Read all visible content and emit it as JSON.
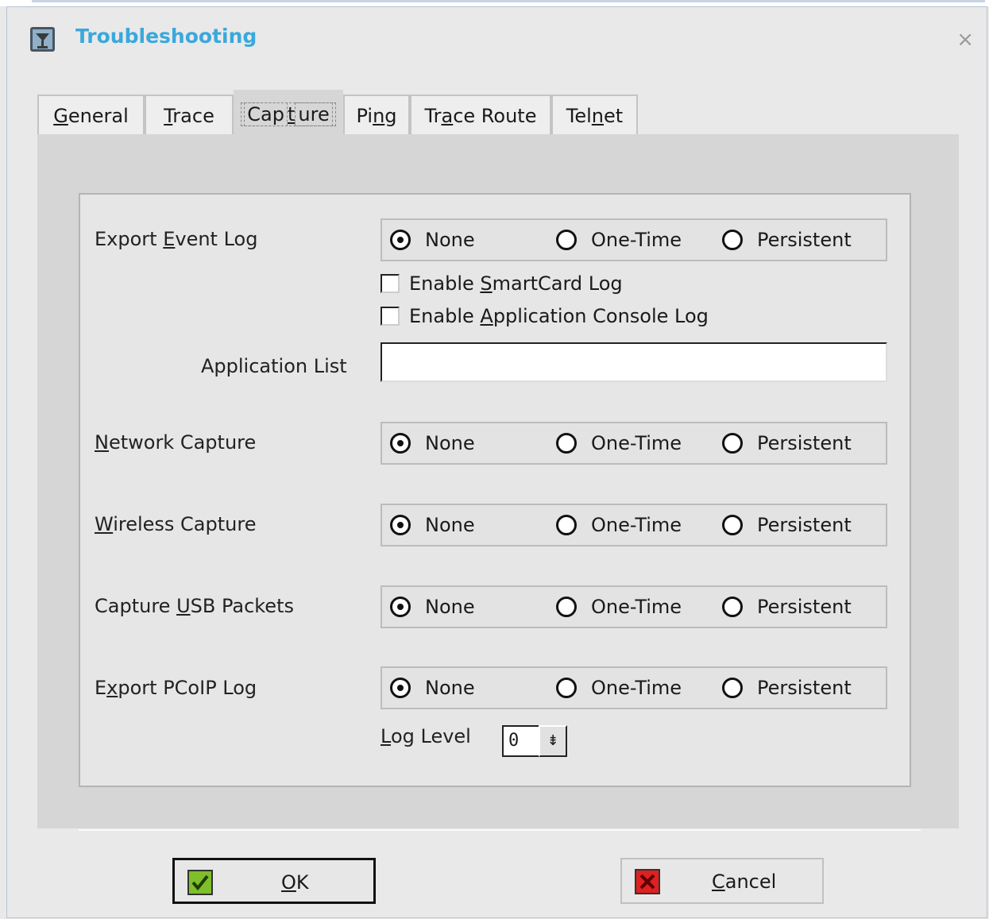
{
  "window": {
    "title": "Troubleshooting",
    "close_glyph": "×",
    "app_icon": "network-tool-icon"
  },
  "tabs": [
    {
      "pre": "",
      "u": "G",
      "post": "eneral"
    },
    {
      "pre": "",
      "u": "T",
      "post": "race"
    },
    {
      "pre": "Cap",
      "u": "t",
      "post": "ure"
    },
    {
      "pre": "Pi",
      "u": "n",
      "post": "g"
    },
    {
      "pre": "Tr",
      "u": "a",
      "post": "ce Route"
    },
    {
      "pre": "Tel",
      "u": "n",
      "post": "et"
    }
  ],
  "options": {
    "none": "None",
    "one_time": "One-Time",
    "persistent": "Persistent"
  },
  "export_event_log": {
    "pre": "Export ",
    "u": "E",
    "post": "vent Log",
    "selected": "None"
  },
  "smartcard": {
    "pre": "Enable ",
    "u": "S",
    "post": "martCard Log",
    "checked": false
  },
  "app_console": {
    "pre": "Enable ",
    "u": "A",
    "post": "pplication Console Log",
    "checked": false
  },
  "application_list": {
    "label": "Application List",
    "value": ""
  },
  "network_capture": {
    "pre": "",
    "u": "N",
    "post": "etwork Capture",
    "selected": "None"
  },
  "wireless_capture": {
    "pre": "",
    "u": "W",
    "post": "ireless Capture",
    "selected": "None"
  },
  "usb_capture": {
    "pre": "Capture ",
    "u": "U",
    "post": "SB Packets",
    "selected": "None"
  },
  "pcoip_log": {
    "pre": "E",
    "u": "x",
    "post": "port PCoIP Log",
    "selected": "None"
  },
  "log_level": {
    "pre": "",
    "u": "L",
    "post": "og Level",
    "value": "0",
    "arrow": "⇟"
  },
  "buttons": {
    "ok": {
      "pre": "",
      "u": "O",
      "post": "K"
    },
    "cancel": {
      "pre": "",
      "u": "C",
      "post": "ancel"
    }
  },
  "colors": {
    "title": "#3aa8dc",
    "ok_icon": "#7fbf2a",
    "cancel_icon": "#e02020"
  }
}
